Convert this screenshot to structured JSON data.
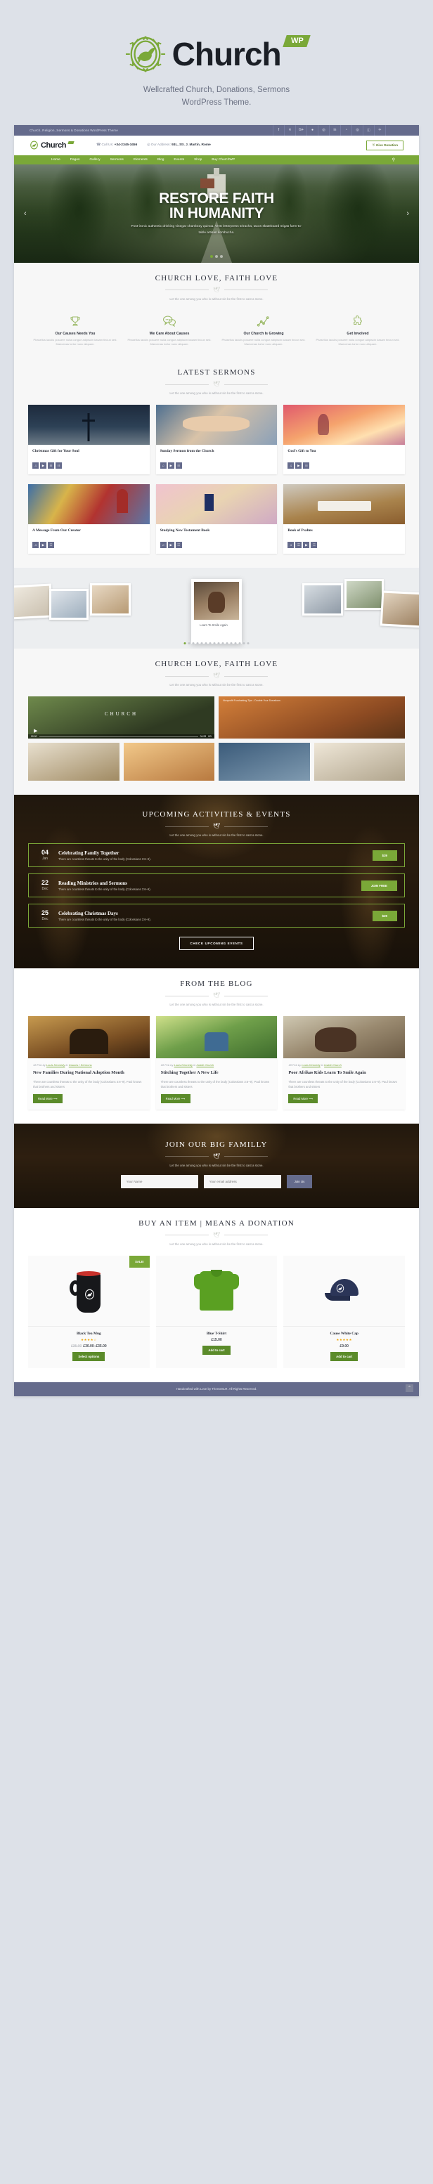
{
  "promo": {
    "brand": "Church",
    "badge": "WP",
    "tagline_line1": "Wellcrafted Church, Donations, Sermons",
    "tagline_line2": "WordPress Theme.",
    "logo_icon": "dove-in-crown-of-thorns-icon"
  },
  "topbar": {
    "text": "Church, Religion, Sermons & Donations WordPress Theme",
    "social": [
      "f",
      "✕",
      "G+",
      "●",
      "◎",
      "in",
      "◔",
      "◎",
      "ⓘ",
      "✈"
    ]
  },
  "header": {
    "brand": "Church",
    "call_label": "Call Us:",
    "call_value": "+34-2345-3456",
    "address_label": "Our Address:",
    "address_value": "93L, Str. J. Martin, Rome",
    "donate_label": "Give Donation",
    "phone_icon": "phone-icon",
    "pin_icon": "map-pin-icon",
    "heart_icon": "heart-icon"
  },
  "nav": {
    "items": [
      {
        "label": "Home",
        "caret": false
      },
      {
        "label": "Pages",
        "caret": true
      },
      {
        "label": "Gallery",
        "caret": true
      },
      {
        "label": "Sermons",
        "caret": true
      },
      {
        "label": "Elements",
        "caret": true
      },
      {
        "label": "Blog",
        "caret": true
      },
      {
        "label": "Events",
        "caret": true
      },
      {
        "label": "Shop",
        "caret": true
      },
      {
        "label": "Buy ChurchWP",
        "caret": false
      }
    ],
    "search_icon": "search-icon"
  },
  "hero": {
    "title_line1": "RESTORE FAITH",
    "title_line2": "IN HUMANITY",
    "subtitle": "Post-ironic authentic drinking vinegar chambray quinoa. VHS letterpress sriracha, tacos skateboard migas farm-to-table artisan kombucha.",
    "prev_icon": "chevron-left-icon",
    "next_icon": "chevron-right-icon",
    "slides": 3,
    "active_slide": 1
  },
  "about": {
    "title": "CHURCH LOVE, FAITH LOVE",
    "subtitle": "Let the one among you who is without sin be the first to cast a stone.",
    "features": [
      {
        "icon": "trophy-icon",
        "title": "Our Causes Needs You",
        "desc": "Phasellus iaculis posuere nulla congue adipiscin kasam tincun sed. Maecenas tortor nunc aliquam."
      },
      {
        "icon": "chat-bubbles-icon",
        "title": "We Care About Causes",
        "desc": "Phasellus iaculis posuere nulla congue adipiscin kasam tincun sed. Maecenas tortor nunc aliquam."
      },
      {
        "icon": "growth-chart-icon",
        "title": "Our Church Is Growing",
        "desc": "Phasellus iaculis posuere nulla congue adipiscin kasam tincun sed. Maecenas tortor nunc aliquam."
      },
      {
        "icon": "puzzle-piece-icon",
        "title": "Get Involved",
        "desc": "Phasellus iaculis posuere nulla congue adipiscin kasam tincun sed. Maecenas tortor nunc aliquam."
      }
    ]
  },
  "sermons": {
    "title": "LATEST SERMONS",
    "subtitle": "Let the one among you who is without sin be the first to cast a stone.",
    "items": [
      {
        "title": "Christmas Gift for Your Soul",
        "img": "im-cross",
        "chips": [
          "♫",
          "▶",
          "☰",
          "☷"
        ]
      },
      {
        "title": "Sunday Sermon from the Church",
        "img": "im-hands",
        "chips": [
          "♫",
          "▶",
          "☷"
        ]
      },
      {
        "title": "God's Gift to You",
        "img": "im-sunset",
        "chips": [
          "♫",
          "▶",
          "☷"
        ]
      },
      {
        "title": "A Message From Our Creator",
        "img": "im-glass",
        "chips": [
          "♫",
          "▶",
          "☷"
        ]
      },
      {
        "title": "Studying New Testament Book",
        "img": "im-bible",
        "chips": [
          "♫",
          "▶",
          "☷"
        ]
      },
      {
        "title": "Book of Psalms",
        "img": "im-altar",
        "chips": [
          "♫",
          "☰",
          "▶",
          "☷"
        ]
      }
    ]
  },
  "gallery": {
    "caption": "Learn To Smile Again",
    "dots": 16,
    "active_dot": 1
  },
  "media": {
    "title": "CHURCH LOVE, FAITH LOVE",
    "subtitle": "Let the one among you who is without sin be the first to cast a stone.",
    "video_label": "CHURCH",
    "video_time": "00:00",
    "video_duration": "04:28",
    "video_hd": "HD",
    "photo_caption": "Nonprofit Fundraising Tips - Double Your Donations"
  },
  "events": {
    "title": "UPCOMING ACTIVITIES & EVENTS",
    "subtitle": "Let the one among you who is without sin be the first to cast a stone.",
    "all_label": "CHECK UPCOMING EVENTS",
    "items": [
      {
        "day": "04",
        "month": "Jan",
        "title": "Celebrating Family Together",
        "desc": "There are countless threats to the unity of the body (Colossians 3:6–9).",
        "btn": "$39"
      },
      {
        "day": "22",
        "month": "Dec",
        "title": "Reading Ministries and Sermons",
        "desc": "There are countless threats to the unity of the body (Colossians 3:6–9).",
        "btn": "JOIN FREE"
      },
      {
        "day": "25",
        "month": "Dec",
        "title": "Celebrating Christmas Days",
        "desc": "There are countless threats to the unity of the body (Colossians 3:6–9).",
        "btn": "$29"
      }
    ]
  },
  "blog": {
    "title": "FROM THE BLOG",
    "subtitle": "Let the one among you who is without sin be the first to cast a stone.",
    "read_more": "Read More",
    "posts": [
      {
        "date": "18 Feb",
        "by": "by",
        "author": "Louis Kennedy",
        "in": "in",
        "cats": "Causes / Sermons",
        "img": "im-int",
        "title": "New Families During National Adoption Month",
        "excerpt": "There are countless threats to the unity of the body (Colossians 3:6–9). Paul knows that brothers and sisters"
      },
      {
        "date": "18 Feb",
        "by": "by",
        "author": "Louis Kennedy",
        "in": "in",
        "cats": "Inside Church",
        "img": "im-arms",
        "title": "Stitching Together A New Life",
        "excerpt": "There are countless threats to the unity of the body (Colossians 3:6–9). Paul knows that brothers and sisters"
      },
      {
        "date": "18 Feb",
        "by": "by",
        "author": "Louis Kennedy",
        "in": "in",
        "cats": "Inside Church",
        "img": "im-kids",
        "title": "Poor Afrikas Kids Learn To Smile Again",
        "excerpt": "There are countless threats to the unity of the body (Colossians 3:6–9). Paul knows that brothers and sisters"
      }
    ]
  },
  "newsletter": {
    "title": "JOIN OUR BIG FAMILLY",
    "subtitle": "Let the one among you who is without sin be the first to cast a stone.",
    "name_placeholder": "Your Name",
    "email_placeholder": "Your email address",
    "submit_label": "Join Us"
  },
  "shop": {
    "title": "BUY AN ITEM | MEANS A DONATION",
    "subtitle": "Let the one among you who is without sin be the first to cast a stone.",
    "sale_badge": "SALE!",
    "products": [
      {
        "name": "Black Tea Mug",
        "stars": "★★★★☆",
        "old_price": "£35.00",
        "price": "£30.00–£35.00",
        "btn": "Select options",
        "sale": true
      },
      {
        "name": "Blue T-Shirt",
        "stars": "",
        "old_price": "",
        "price": "£15.00",
        "btn": "Add to cart",
        "sale": false
      },
      {
        "name": "Cause White Cap",
        "stars": "★★★★★",
        "old_price": "",
        "price": "£9.00",
        "btn": "Add to cart",
        "sale": false
      }
    ]
  },
  "footer": {
    "text": "Handcrafted with Love by ThemeSLR. All Rights Reserved.",
    "to_top_icon": "chevron-up-icon"
  },
  "colors": {
    "green": "#7aa838",
    "purple": "#656b8c",
    "dark": "#1b1f26"
  }
}
